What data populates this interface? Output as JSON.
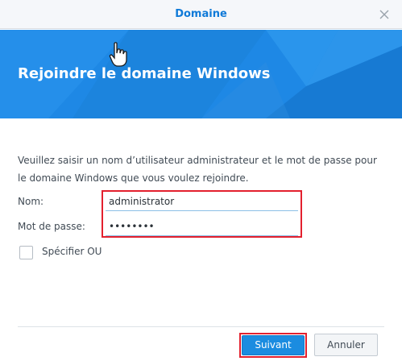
{
  "dialog": {
    "title": "Domaine",
    "close_icon": "close-icon"
  },
  "banner": {
    "heading": "Rejoindre le domaine Windows",
    "color": "#1e88e5"
  },
  "description": "Veuillez saisir un nom d’utilisateur administrateur et le mot de passe pour le domaine Windows que vous voulez rejoindre.",
  "form": {
    "name_label": "Nom:",
    "name_value": "administrator",
    "password_label": "Mot de passe:",
    "password_value": "••••••••",
    "ou_checkbox_label": "Spécifier OU",
    "ou_checked": false
  },
  "buttons": {
    "next_label": "Suivant",
    "cancel_label": "Annuler"
  },
  "colors": {
    "accent": "#0f7ad8",
    "primary_button": "#1b8ce0",
    "annotation_highlight": "#e3202e"
  }
}
